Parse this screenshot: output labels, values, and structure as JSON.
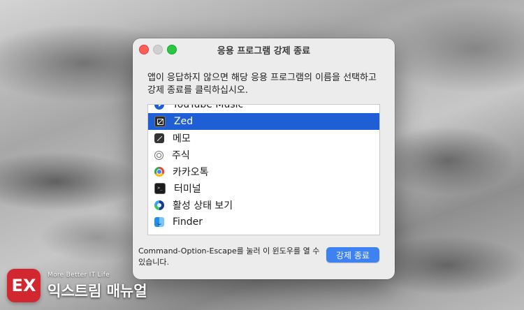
{
  "window": {
    "title": "응용 프로그램 강제 종료",
    "instructions": "앱이 응답하지 않으면 해당 응용 프로그램의 이름을 선택하고 강제 종료를 클릭하십시오.",
    "footer_text": "Command-Option-Escape를 눌러 이 윈도우를 열 수 있습니다.",
    "button_label": "강제 종료"
  },
  "apps": [
    {
      "name": "YouTube Music",
      "icon": "youtube-music-icon",
      "selected": false
    },
    {
      "name": "Zed",
      "icon": "zed-icon",
      "selected": true
    },
    {
      "name": "메모",
      "icon": "notes-icon",
      "selected": false
    },
    {
      "name": "주식",
      "icon": "stocks-icon",
      "selected": false
    },
    {
      "name": "카카오톡",
      "icon": "chrome-icon",
      "selected": false
    },
    {
      "name": "터미널",
      "icon": "terminal-icon",
      "selected": false
    },
    {
      "name": "활성 상태 보기",
      "icon": "activity-monitor-icon",
      "selected": false
    },
    {
      "name": "Finder",
      "icon": "finder-icon",
      "selected": false
    }
  ],
  "watermark": {
    "logo": "EX",
    "tagline": "More Better IT Life",
    "name": "익스트림 매뉴얼"
  },
  "colors": {
    "selection": "#1f5fd6",
    "button": "#3d82f0",
    "close": "#ff5f57",
    "maximize": "#28c840",
    "logo": "#d2272e"
  }
}
